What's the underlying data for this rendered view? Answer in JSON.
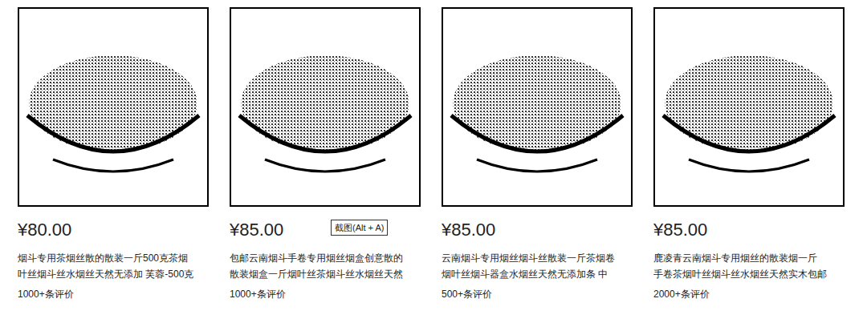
{
  "products": [
    {
      "price": "¥80.00",
      "title_lines": [
        "烟斗专用茶烟丝散的散装一斤500克茶烟",
        "叶丝烟斗丝水烟丝天然无添加 芙蓉-500克"
      ],
      "reviews": "1000+条评价"
    },
    {
      "price": "¥85.00",
      "title_lines": [
        "包邮云南烟斗手卷专用烟丝烟盒创意散的",
        "散装烟盒一斤烟叶丝茶烟斗丝水烟丝天然"
      ],
      "reviews": "1000+条评价"
    },
    {
      "price": "¥85.00",
      "title_lines": [
        "云南烟斗专用烟丝烟斗丝散装一斤茶烟卷",
        "烟叶丝烟斗器盒水烟丝天然无添加条 中"
      ],
      "reviews": "500+条评价"
    },
    {
      "price": "¥85.00",
      "title_lines": [
        "鹿凌青云南烟斗专用烟丝的散装烟一斤",
        "手卷茶烟叶丝烟斗丝水烟丝天然实木包邮"
      ],
      "reviews": "2000+条评价"
    }
  ],
  "tooltip": {
    "text": "截图(Alt + A)",
    "product_index": 1
  }
}
